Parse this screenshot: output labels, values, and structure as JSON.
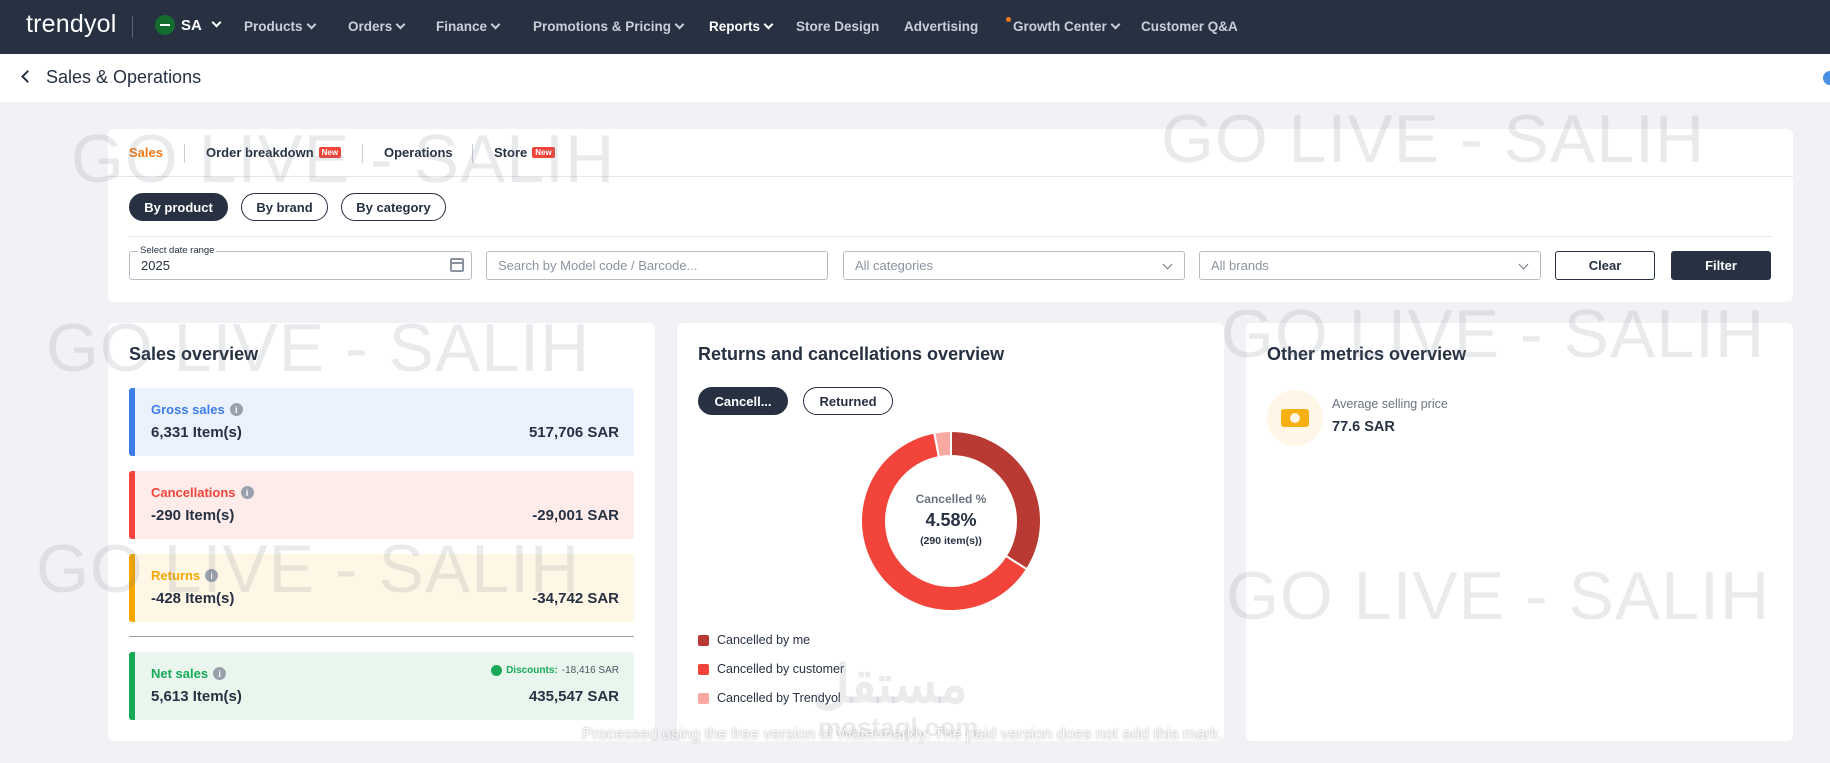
{
  "app": {
    "logo": "trendyol",
    "country": "SA"
  },
  "nav": {
    "items": [
      {
        "label": "Products",
        "dropdown": true
      },
      {
        "label": "Orders",
        "dropdown": true
      },
      {
        "label": "Finance",
        "dropdown": true
      },
      {
        "label": "Promotions & Pricing",
        "dropdown": true
      },
      {
        "label": "Reports",
        "dropdown": true,
        "active": true
      },
      {
        "label": "Store Design",
        "dropdown": false
      },
      {
        "label": "Advertising",
        "dropdown": false
      },
      {
        "label": "Growth Center",
        "dropdown": true,
        "dot": true
      },
      {
        "label": "Customer Q&A",
        "dropdown": false
      }
    ]
  },
  "page": {
    "title": "Sales & Operations"
  },
  "tabs": [
    {
      "label": "Sales",
      "active": true
    },
    {
      "label": "Order breakdown",
      "badge": "New"
    },
    {
      "label": "Operations"
    },
    {
      "label": "Store",
      "badge": "New"
    }
  ],
  "view_toggle": {
    "options": [
      "By product",
      "By brand",
      "By category"
    ],
    "selected": "By product"
  },
  "filters": {
    "date_range_label": "Select date range",
    "date_range_value": "2025",
    "search_placeholder": "Search by Model code / Barcode...",
    "category_value": "All categories",
    "brand_value": "All brands",
    "clear_label": "Clear",
    "filter_label": "Filter"
  },
  "sales_overview": {
    "title": "Sales overview",
    "metrics": [
      {
        "name": "Gross sales",
        "items": "6,331 Item(s)",
        "amount": "517,706 SAR",
        "color": "#3d7de8",
        "bg": "#ebf2fd"
      },
      {
        "name": "Cancellations",
        "items": "-290 Item(s)",
        "amount": "-29,001 SAR",
        "color": "#f2443a",
        "bg": "#fdecea"
      },
      {
        "name": "Returns",
        "items": "-428 Item(s)",
        "amount": "-34,742 SAR",
        "color": "#f6a800",
        "bg": "#fff7e6"
      }
    ],
    "net": {
      "name": "Net sales",
      "items": "5,613 Item(s)",
      "amount": "435,547 SAR",
      "discount_label": "Discounts:",
      "discount_value": "-18,416 SAR",
      "color": "#18a957",
      "bg": "#e8f6ee"
    }
  },
  "returns_overview": {
    "title": "Returns and cancellations overview",
    "toggle": [
      "Cancell...",
      "Returned"
    ],
    "selected": "Cancell...",
    "center_label": "Cancelled %",
    "center_value": "4.58%",
    "center_sub": "(290 item(s))"
  },
  "chart_data": {
    "type": "pie",
    "donut": true,
    "series": [
      {
        "name": "Cancelled by me",
        "value": 0.34,
        "color": "#b83a32"
      },
      {
        "name": "Cancelled by customer",
        "value": 0.63,
        "color": "#f2443a"
      },
      {
        "name": "Cancelled by Trendyol",
        "value": 0.03,
        "color": "#f8a9a2"
      }
    ]
  },
  "other_metrics": {
    "title": "Other metrics overview",
    "asp_label": "Average selling price",
    "asp_value": "77.6 SAR"
  },
  "watermarks": {
    "text": "GO LIVE - SALIH",
    "footer": "Processed using the free version of Watermarkly. The paid version does not add this mark.",
    "arabic": "مستقل",
    "site": "mostaql.com"
  }
}
